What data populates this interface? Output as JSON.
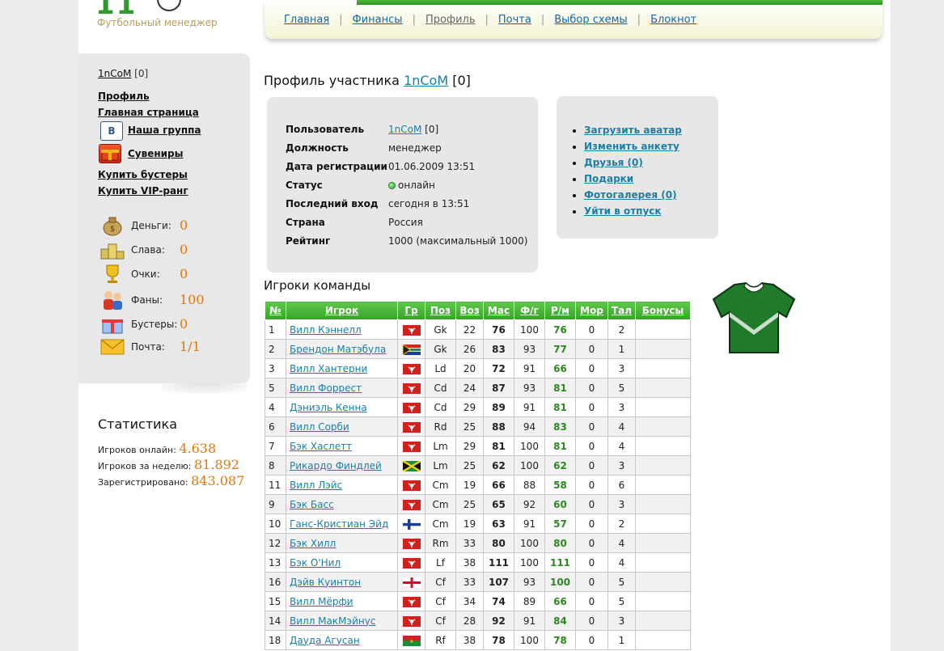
{
  "logo": {
    "sub": "Футбольный менеджер"
  },
  "nav": {
    "items": [
      {
        "label": "Главная",
        "active": false
      },
      {
        "label": "Финансы",
        "active": false
      },
      {
        "label": "Профиль",
        "active": true
      },
      {
        "label": "Почта",
        "active": false
      },
      {
        "label": "Выбор схемы",
        "active": false
      },
      {
        "label": "Блокнот",
        "active": false
      }
    ]
  },
  "sidebar": {
    "user": "1nCoM",
    "user_suffix": "[0]",
    "links": {
      "profile": "Профиль",
      "home": "Главная страница",
      "group": "Наша группа",
      "souvenirs": "Сувениры",
      "buy_boosters": "Купить бустеры",
      "buy_vip": "Купить VIP-ранг"
    },
    "group_icon_letter": "В",
    "stats": [
      {
        "icon": "money-bag-icon",
        "label": "Деньги:",
        "value": "0"
      },
      {
        "icon": "podium-icon",
        "label": "Слава:",
        "value": "0"
      },
      {
        "icon": "trophy-icon",
        "label": "Очки:",
        "value": "0"
      },
      {
        "icon": "fans-icon",
        "label": "Фаны:",
        "value": "100"
      },
      {
        "icon": "gift-icon",
        "label": "Бустеры:",
        "value": "0"
      },
      {
        "icon": "mail-icon",
        "label": "Почта:",
        "value": "1/1"
      }
    ]
  },
  "statistics": {
    "title": "Статистика",
    "online_label": "Игроков онлайн:",
    "online_value": "4.638",
    "week_label": "Игроков за неделю:",
    "week_value": "81.892",
    "registered_label": "Зарегистрировано:",
    "registered_value": "843.087"
  },
  "profile": {
    "title_prefix": "Профиль участника",
    "user": "1nCoM",
    "user_suffix": "[0]",
    "rows": [
      {
        "key": "Пользователь",
        "value": "1nCoM",
        "suffix": "[0]"
      },
      {
        "key": "Должность",
        "value": "менеджер"
      },
      {
        "key": "Дата регистрации",
        "value": "01.06.2009 13:51"
      },
      {
        "key": "Статус",
        "value": "онлайн"
      },
      {
        "key": "Последний вход",
        "value": "сегодня в 13:51"
      },
      {
        "key": "Страна",
        "value": "Россия"
      },
      {
        "key": "Рейтинг",
        "value": "1000 (максимальный 1000)"
      }
    ],
    "actions": [
      "Загрузить аватар",
      "Изменить анкету",
      "Друзья (0)",
      "Подарки",
      "Фотогалерея (0)",
      "Уйти в отпуск"
    ]
  },
  "team": {
    "title": "Игроки команды",
    "columns": [
      "№",
      "Игрок",
      "Гр",
      "Поз",
      "Воз",
      "Мас",
      "Ф/г",
      "Р/м",
      "Мор",
      "Тал",
      "Бонусы"
    ],
    "rows": [
      {
        "n": "1",
        "name": "Вилл Кэннелл",
        "flag": "isle-of-man",
        "pos": "Gk",
        "age": "22",
        "mas": "76",
        "fg": "100",
        "rm": "76",
        "mor": "0",
        "tal": "2",
        "bonus": ""
      },
      {
        "n": "2",
        "name": "Брендон Матэбула",
        "flag": "south-africa",
        "pos": "Gk",
        "age": "26",
        "mas": "83",
        "fg": "93",
        "rm": "77",
        "mor": "0",
        "tal": "1",
        "bonus": ""
      },
      {
        "n": "3",
        "name": "Вилл Хантерни",
        "flag": "isle-of-man",
        "pos": "Ld",
        "age": "20",
        "mas": "72",
        "fg": "91",
        "rm": "66",
        "mor": "0",
        "tal": "3",
        "bonus": ""
      },
      {
        "n": "5",
        "name": "Вилл Форрест",
        "flag": "isle-of-man",
        "pos": "Cd",
        "age": "24",
        "mas": "87",
        "fg": "93",
        "rm": "81",
        "mor": "0",
        "tal": "5",
        "bonus": ""
      },
      {
        "n": "4",
        "name": "Дэниэль Кенна",
        "flag": "isle-of-man",
        "pos": "Cd",
        "age": "29",
        "mas": "89",
        "fg": "91",
        "rm": "81",
        "mor": "0",
        "tal": "3",
        "bonus": ""
      },
      {
        "n": "6",
        "name": "Вилл Сорби",
        "flag": "isle-of-man",
        "pos": "Rd",
        "age": "25",
        "mas": "88",
        "fg": "94",
        "rm": "83",
        "mor": "0",
        "tal": "4",
        "bonus": ""
      },
      {
        "n": "7",
        "name": "Бэк Хаслетт",
        "flag": "isle-of-man",
        "pos": "Lm",
        "age": "29",
        "mas": "81",
        "fg": "100",
        "rm": "81",
        "mor": "0",
        "tal": "4",
        "bonus": ""
      },
      {
        "n": "8",
        "name": "Рикардо Финдлей",
        "flag": "jamaica",
        "pos": "Lm",
        "age": "25",
        "mas": "62",
        "fg": "100",
        "rm": "62",
        "mor": "0",
        "tal": "3",
        "bonus": ""
      },
      {
        "n": "11",
        "name": "Вилл Лэйс",
        "flag": "isle-of-man",
        "pos": "Cm",
        "age": "19",
        "mas": "66",
        "fg": "88",
        "rm": "58",
        "mor": "0",
        "tal": "6",
        "bonus": ""
      },
      {
        "n": "9",
        "name": "Бэк Басс",
        "flag": "isle-of-man",
        "pos": "Cm",
        "age": "25",
        "mas": "65",
        "fg": "92",
        "rm": "60",
        "mor": "0",
        "tal": "3",
        "bonus": ""
      },
      {
        "n": "10",
        "name": "Ганс-Кристиан Эйд",
        "flag": "finland",
        "pos": "Cm",
        "age": "19",
        "mas": "63",
        "fg": "91",
        "rm": "57",
        "mor": "0",
        "tal": "2",
        "bonus": ""
      },
      {
        "n": "12",
        "name": "Бэк Хилл",
        "flag": "isle-of-man",
        "pos": "Rm",
        "age": "33",
        "mas": "80",
        "fg": "100",
        "rm": "80",
        "mor": "0",
        "tal": "4",
        "bonus": ""
      },
      {
        "n": "13",
        "name": "Бэк О'Нил",
        "flag": "isle-of-man",
        "pos": "Lf",
        "age": "38",
        "mas": "111",
        "fg": "100",
        "rm": "111",
        "mor": "0",
        "tal": "4",
        "bonus": ""
      },
      {
        "n": "16",
        "name": "Дэйв Куинтон",
        "flag": "england",
        "pos": "Cf",
        "age": "33",
        "mas": "107",
        "fg": "93",
        "rm": "100",
        "mor": "0",
        "tal": "5",
        "bonus": ""
      },
      {
        "n": "15",
        "name": "Вилл Мёрфи",
        "flag": "isle-of-man",
        "pos": "Cf",
        "age": "34",
        "mas": "74",
        "fg": "89",
        "rm": "66",
        "mor": "0",
        "tal": "5",
        "bonus": ""
      },
      {
        "n": "14",
        "name": "Вилл МакМэйнус",
        "flag": "isle-of-man",
        "pos": "Cf",
        "age": "28",
        "mas": "92",
        "fg": "91",
        "rm": "84",
        "mor": "0",
        "tal": "3",
        "bonus": ""
      },
      {
        "n": "18",
        "name": "Дауда Агусан",
        "flag": "burkina-faso",
        "pos": "Rf",
        "age": "38",
        "mas": "78",
        "fg": "100",
        "rm": "78",
        "mor": "0",
        "tal": "1",
        "bonus": ""
      }
    ]
  },
  "colors": {
    "accent_green": "#36a228",
    "link_blue": "#1a7fa8",
    "stat_orange": "#e0790c",
    "shirt_green": "#1f7a2a"
  }
}
